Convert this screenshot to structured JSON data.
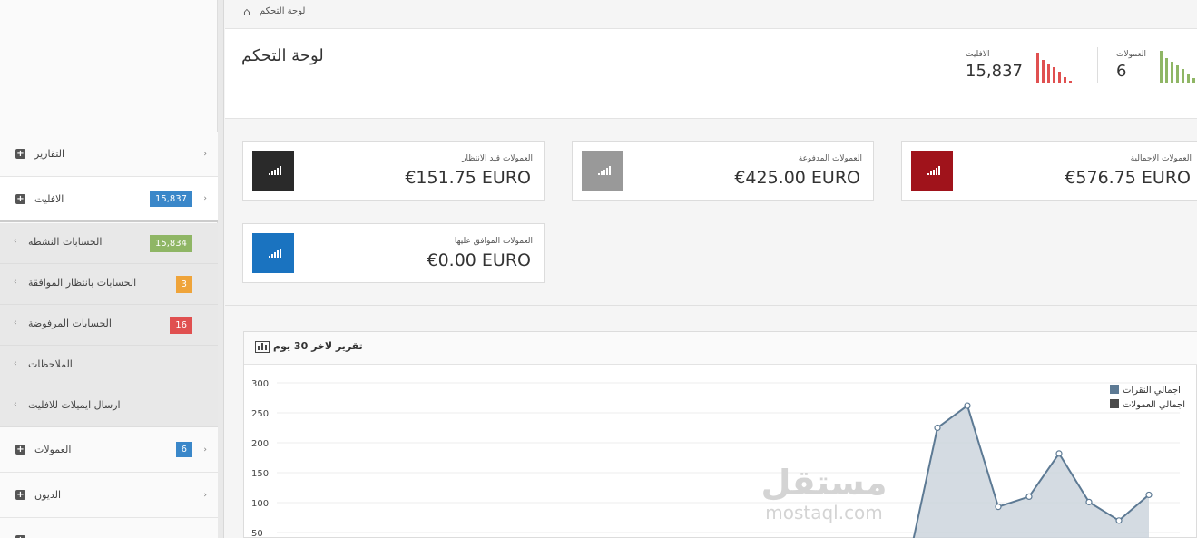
{
  "colors": {
    "blue": "#3a87c9",
    "green": "#8fb665",
    "orange": "#efa43a",
    "red": "#e05050",
    "dark_red": "#a0131b",
    "gray": "#999999",
    "dark": "#2a2a2a",
    "blue_icon": "#1a73c0"
  },
  "sidebar": {
    "items": [
      {
        "label": "التقارير",
        "badge": ""
      },
      {
        "label": "الافليت",
        "badge": "15,837"
      },
      {
        "label": "العمولات",
        "badge": "6"
      },
      {
        "label": "الديون",
        "badge": ""
      }
    ],
    "sub_items": [
      {
        "label": "الحسابات النشطه",
        "badge": "15,834"
      },
      {
        "label": "الحسابات بانتظار الموافقة",
        "badge": "3"
      },
      {
        "label": "الحسابات المرفوضة",
        "badge": "16"
      },
      {
        "label": "الملاحظات",
        "badge": ""
      },
      {
        "label": "ارسال ايميلات للافليت",
        "badge": ""
      }
    ]
  },
  "breadcrumb": {
    "label": "لوحة التحكم"
  },
  "header": {
    "title": "لوحة التحكم",
    "stats": [
      {
        "label": "الافليت",
        "value": "15,837"
      },
      {
        "label": "العمولات",
        "value": "6"
      }
    ]
  },
  "cards": [
    {
      "label": "العمولات قيد الانتظار",
      "value": "€151.75 EURO"
    },
    {
      "label": "العمولات المدفوعة",
      "value": "€425.00 EURO"
    },
    {
      "label": "العمولات الإجمالية",
      "value": "€576.75 EURO"
    },
    {
      "label": "العمولات الموافق عليها",
      "value": "€0.00 EURO"
    }
  ],
  "report": {
    "title": "تقرير لاخر 30 يوم"
  },
  "chart_data": {
    "type": "area",
    "y_ticks": [
      "300",
      "250",
      "200",
      "150",
      "100",
      "50"
    ],
    "ylim": [
      0,
      300
    ],
    "legend_position": "top-right",
    "series": [
      {
        "name": "اجمالي النقرات",
        "color": "#5d7a94",
        "values": [
          0,
          0,
          225,
          262,
          93,
          110,
          182,
          101,
          70,
          113
        ]
      },
      {
        "name": "اجمالي العمولات",
        "color": "#4a4a4a",
        "values": []
      }
    ]
  },
  "watermark": {
    "line1": "مستقل",
    "line2": "mostaql.com"
  }
}
